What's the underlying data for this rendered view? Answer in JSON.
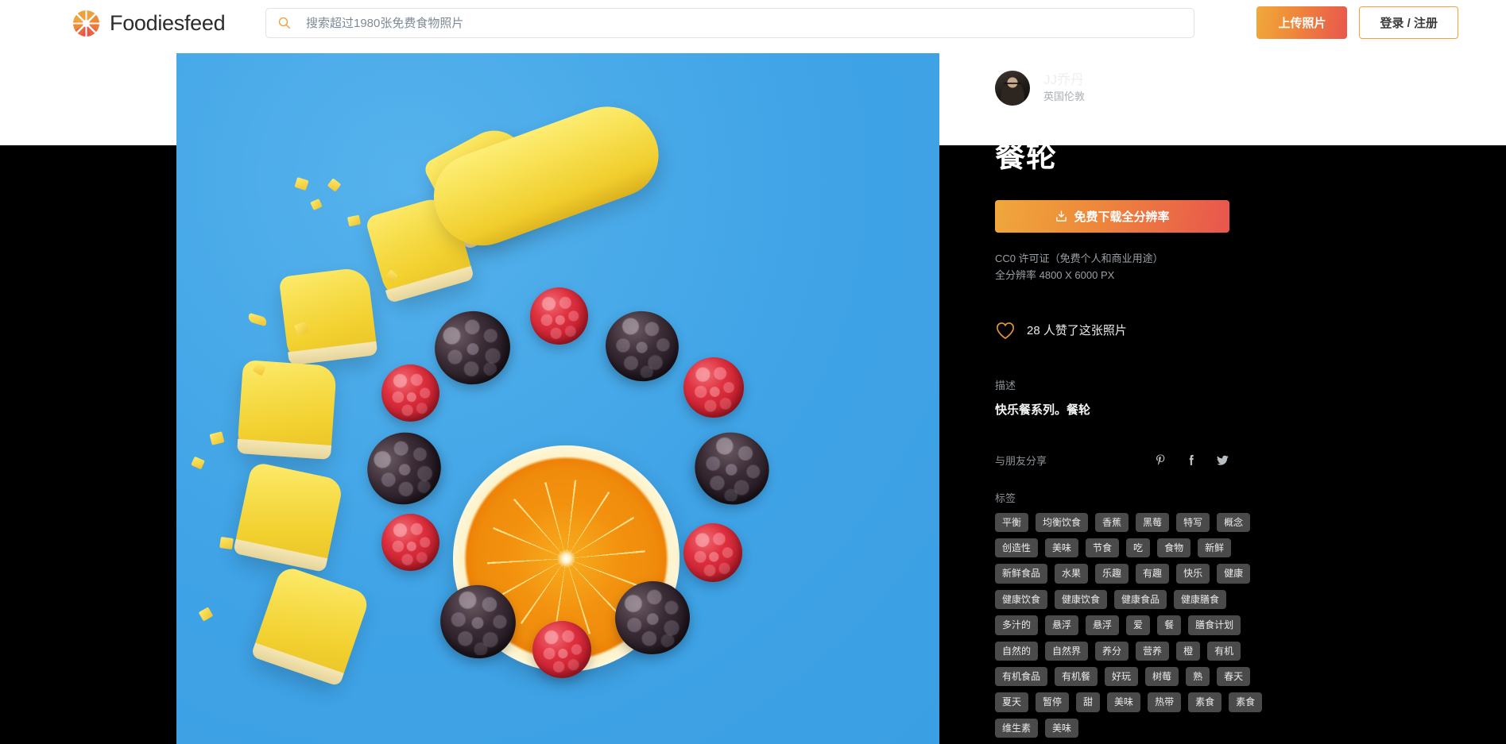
{
  "header": {
    "brand_name": "Foodiesfeed",
    "logo_icon": "aperture-icon",
    "search": {
      "icon": "search-icon",
      "placeholder": "搜索超过1980张免费食物照片",
      "value": ""
    },
    "upload_label": "上传照片",
    "login_label": "登录 / 注册"
  },
  "photo": {
    "alt": "蓝色背景上的橙子片、覆盆子、黑莓和香蕉块组成的圆轮",
    "background_color": "#47aaea"
  },
  "detail": {
    "author": {
      "name": "JJ乔丹",
      "location": "英国伦敦",
      "avatar_icon": "avatar"
    },
    "title": "餐轮",
    "download_label": "免费下载全分辨率",
    "download_icon": "download-icon",
    "license_line1": "CC0 许可证（免费个人和商业用途）",
    "license_line2": "全分辨率 4800 X 6000 PX",
    "likes": {
      "icon": "heart-icon",
      "text": "28 人赞了这张照片"
    },
    "description_label": "描述",
    "description_text": "快乐餐系列。餐轮",
    "share_label": "与朋友分享",
    "share_icons": [
      "pinterest-icon",
      "facebook-icon",
      "twitter-icon"
    ],
    "tags_label": "标签",
    "tags": [
      "平衡",
      "均衡饮食",
      "香蕉",
      "黑莓",
      "特写",
      "概念",
      "创造性",
      "美味",
      "节食",
      "吃",
      "食物",
      "新鲜",
      "新鲜食品",
      "水果",
      "乐趣",
      "有趣",
      "快乐",
      "健康",
      "健康饮食",
      "健康饮食",
      "健康食品",
      "健康膳食",
      "多汁的",
      "悬浮",
      "悬浮",
      "爱",
      "餐",
      "膳食计划",
      "自然的",
      "自然界",
      "养分",
      "营养",
      "橙",
      "有机",
      "有机食品",
      "有机餐",
      "好玩",
      "树莓",
      "熟",
      "春天",
      "夏天",
      "暂停",
      "甜",
      "美味",
      "热带",
      "素食",
      "素食",
      "维生素",
      "美味"
    ]
  },
  "colors": {
    "accent_start": "#efa83b",
    "accent_end": "#e8564d",
    "panel_bg": "#000000",
    "tag_bg": "#4a4a4a"
  }
}
